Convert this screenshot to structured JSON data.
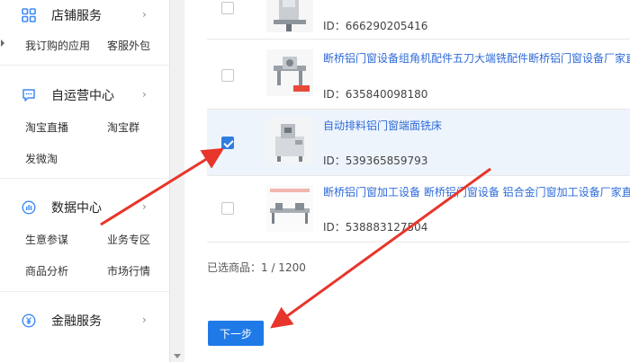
{
  "sidebar": {
    "sections": [
      {
        "title": "店铺服务",
        "icon": "grid-icon",
        "items": [
          "我订购的应用",
          "客服外包"
        ]
      },
      {
        "title": "自运营中心",
        "icon": "chat-icon",
        "items": [
          "淘宝直播",
          "淘宝群",
          "发微淘"
        ]
      },
      {
        "title": "数据中心",
        "icon": "chart-icon",
        "items": [
          "生意参谋",
          "业务专区",
          "商品分析",
          "市场行情"
        ]
      },
      {
        "title": "金融服务",
        "icon": "yuan-icon",
        "items": []
      }
    ]
  },
  "products": [
    {
      "title": "",
      "id": "ID：666290205416",
      "checked": false
    },
    {
      "title": "断桥铝门窗设备组角机配件五刀大端铣配件断桥铝门窗设备厂家直",
      "id": "ID：635840098180",
      "checked": false
    },
    {
      "title": "自动排料铝门窗端面铣床",
      "id": "ID：539365859793",
      "checked": true
    },
    {
      "title": "断桥铝门窗加工设备 断桥铝门窗设备 铝合金门窗加工设备厂家直",
      "id": "ID：538883127504",
      "checked": false
    }
  ],
  "selection": {
    "label": "已选商品：1 / 1200"
  },
  "actions": {
    "next_label": "下一步"
  },
  "colors": {
    "accent": "#1f7ae8",
    "link": "#2f6bd8",
    "annotation": "#e8352b"
  }
}
